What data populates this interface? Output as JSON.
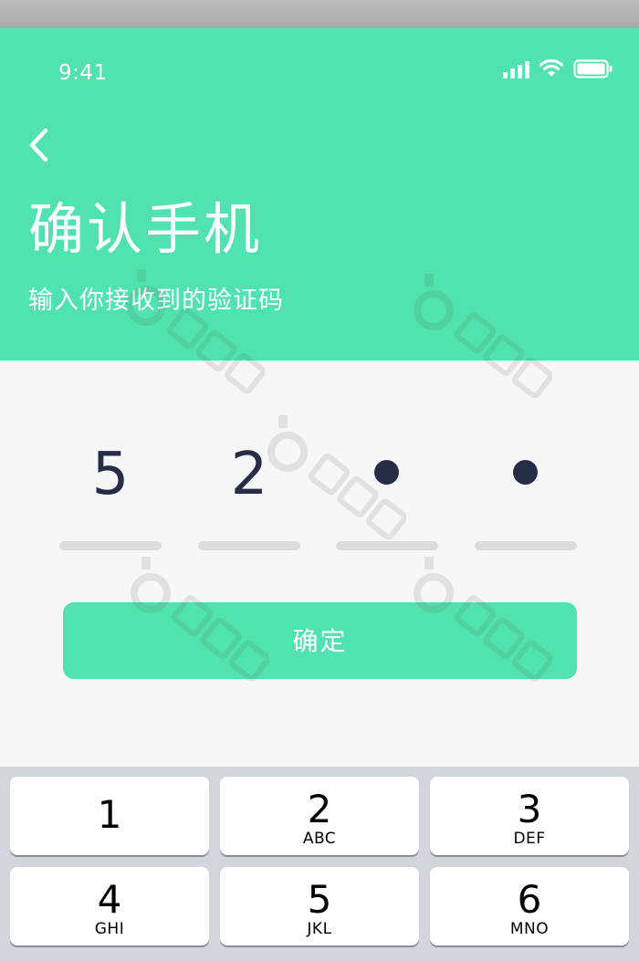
{
  "status_bar": {
    "time": "9:41",
    "icons": [
      "signal-icon",
      "wifi-icon",
      "battery-icon"
    ]
  },
  "header": {
    "back_icon": "chevron-left-icon",
    "title": "确认手机",
    "subtitle": "输入你接收到的验证码"
  },
  "code": {
    "digits": [
      "5",
      "2",
      "",
      ""
    ],
    "masked": [
      false,
      false,
      true,
      true
    ]
  },
  "confirm_button": {
    "label": "确定"
  },
  "keyboard": {
    "keys": [
      {
        "num": "1",
        "letters": ""
      },
      {
        "num": "2",
        "letters": "ABC"
      },
      {
        "num": "3",
        "letters": "DEF"
      },
      {
        "num": "4",
        "letters": "GHI"
      },
      {
        "num": "5",
        "letters": "JKL"
      },
      {
        "num": "6",
        "letters": "MNO"
      }
    ]
  },
  "colors": {
    "accent": "#50e3b0",
    "background": "#f7f7f7",
    "digit": "#262d47",
    "keyboard_bg": "#d2d5db"
  }
}
